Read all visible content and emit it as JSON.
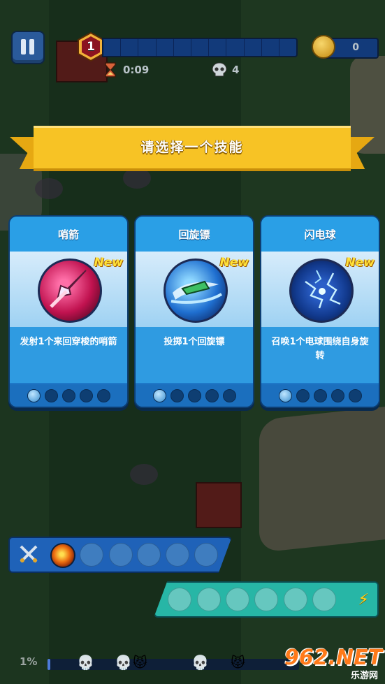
{
  "hud": {
    "level": "1",
    "timer": "0:09",
    "kills": "4",
    "coins": "0",
    "xp_progress": 0
  },
  "prompt": {
    "title": "请选择一个技能"
  },
  "skills": [
    {
      "name": "哨箭",
      "description": "发射1个来回穿梭的哨箭",
      "badge": "New",
      "icon": "arrow-orb-icon",
      "level": 1,
      "max_level": 5
    },
    {
      "name": "回旋镖",
      "description": "投掷1个回旋镖",
      "badge": "New",
      "icon": "boomerang-orb-icon",
      "level": 1,
      "max_level": 5
    },
    {
      "name": "闪电球",
      "description": "召唤1个电球围绕自身旋转",
      "badge": "New",
      "icon": "lightning-orb-icon",
      "level": 1,
      "max_level": 5
    }
  ],
  "weapon_slots": {
    "icon": "crossed-swords-icon",
    "filled": [
      "fireball-icon"
    ],
    "total": 6
  },
  "passive_slots": {
    "icon": "lightning-bolt-icon",
    "filled": [],
    "total": 6
  },
  "stage": {
    "progress_text": "1%",
    "progress": 0.01
  },
  "watermark": {
    "big": "962.NET",
    "small": "乐游网"
  },
  "colors": {
    "card_blue": "#1e78c8",
    "banner_yellow": "#f7c325",
    "new_badge": "#ffe23a"
  }
}
